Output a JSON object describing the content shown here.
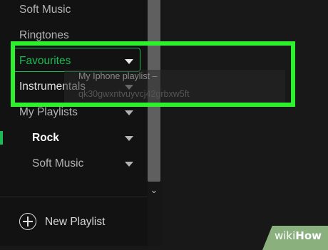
{
  "sidebar": {
    "items": [
      {
        "label": "Soft Music",
        "caret": false
      },
      {
        "label": "Ringtones",
        "caret": false
      },
      {
        "label": "Favourites",
        "caret": true
      },
      {
        "label": "Instrumentals",
        "caret": true
      },
      {
        "label": "My Playlists",
        "caret": true
      },
      {
        "label": "Rock",
        "caret": true
      },
      {
        "label": "Soft Music",
        "caret": true
      }
    ],
    "new_playlist_label": "New Playlist"
  },
  "drag_ghost": {
    "title": "My Iphone playlist –",
    "subtitle": "qk30gwxntvuyvcj42grbxw5ft"
  },
  "colors": {
    "accent": "#1db954",
    "highlight": "#2ff02f",
    "background": "#121212"
  },
  "watermark": {
    "text_wiki": "wiki",
    "text_how": "How"
  }
}
